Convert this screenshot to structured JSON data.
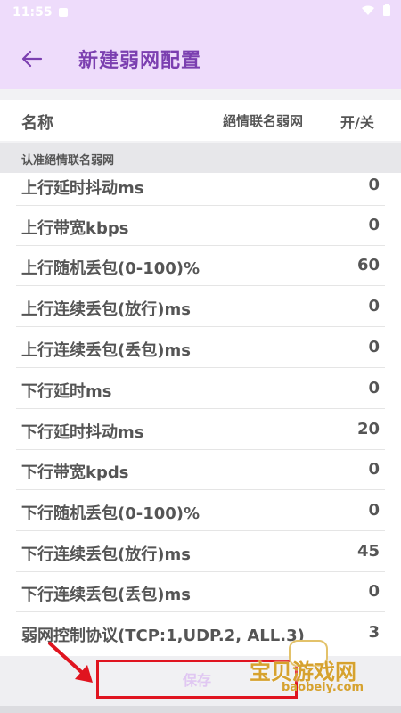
{
  "status_bar": {
    "time": "11:55"
  },
  "header": {
    "title": "新建弱网配置"
  },
  "table_header": {
    "name": "名称",
    "target": "絕情联名弱网",
    "toggle": "开/关"
  },
  "section": {
    "label": "认准絕情联名弱网"
  },
  "rows": [
    {
      "label": "上行延时抖动ms",
      "value": "0"
    },
    {
      "label": "上行带宽kbps",
      "value": "0"
    },
    {
      "label": "上行随机丢包(0-100)%",
      "value": "60"
    },
    {
      "label": "上行连续丢包(放行)ms",
      "value": "0"
    },
    {
      "label": "上行连续丢包(丢包)ms",
      "value": "0"
    },
    {
      "label": "下行延时ms",
      "value": "0"
    },
    {
      "label": "下行延时抖动ms",
      "value": "20"
    },
    {
      "label": "下行带宽kpds",
      "value": "0"
    },
    {
      "label": "下行随机丢包(0-100)%",
      "value": "0"
    },
    {
      "label": "下行连续丢包(放行)ms",
      "value": "45"
    },
    {
      "label": "下行连续丢包(丢包)ms",
      "value": "0"
    },
    {
      "label": "弱网控制协议(TCP:1,UDP.2, ALL.3)",
      "value": "3"
    }
  ],
  "save": {
    "label": "保存"
  },
  "watermark": {
    "text": "宝贝游戏网",
    "url": "baobeiy.com"
  },
  "colors": {
    "accent": "#7b3fb0",
    "app_bar": "#eedcfb",
    "highlight_border": "#e0141f"
  }
}
